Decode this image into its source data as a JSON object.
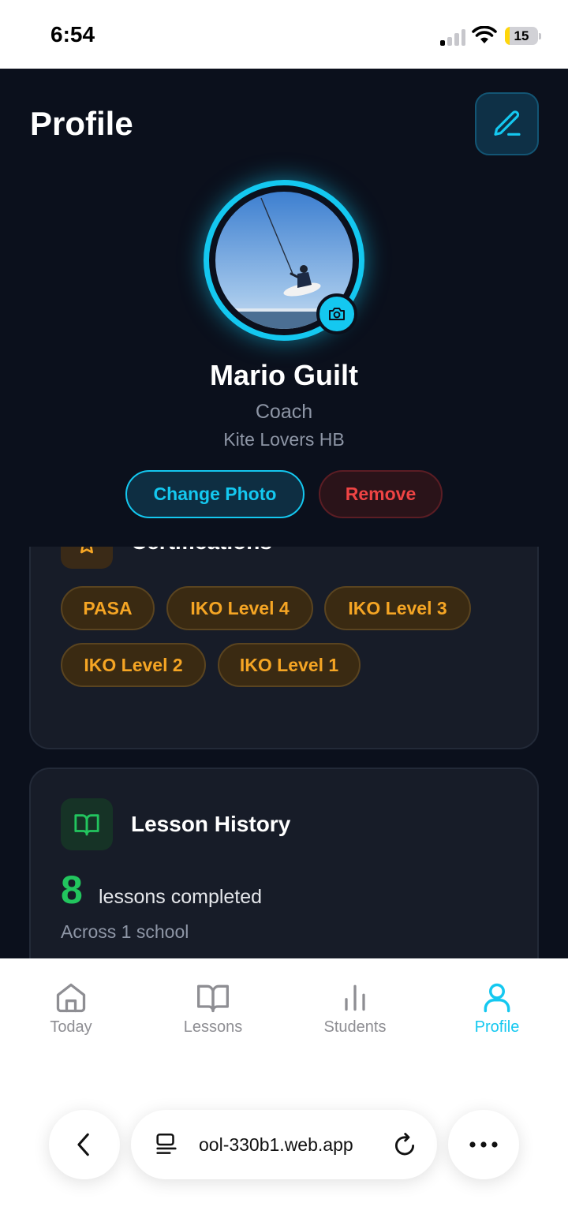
{
  "status_bar": {
    "time": "6:54",
    "battery": "15",
    "battery_level": 0.15,
    "icons": [
      "signal-icon",
      "wifi-icon",
      "battery-icon"
    ]
  },
  "header": {
    "title": "Profile",
    "edit_icon": "pencil-icon"
  },
  "profile": {
    "name": "Mario Guilt",
    "role": "Coach",
    "school": "Kite Lovers HB",
    "camera_icon": "camera-icon",
    "change_photo_label": "Change Photo",
    "remove_label": "Remove"
  },
  "certifications": {
    "title": "Certifications",
    "icon": "award-icon",
    "items": [
      "PASA",
      "IKO Level 4",
      "IKO Level 3",
      "IKO Level 2",
      "IKO Level 1"
    ]
  },
  "lesson_history": {
    "title": "Lesson History",
    "icon": "book-open-icon",
    "count": "8",
    "count_label": "lessons completed",
    "subtitle": "Across 1 school"
  },
  "tabbar": {
    "tabs": [
      {
        "label": "Today",
        "icon": "home-icon",
        "active": false
      },
      {
        "label": "Lessons",
        "icon": "book-open-icon",
        "active": false
      },
      {
        "label": "Students",
        "icon": "bar-chart-icon",
        "active": false
      },
      {
        "label": "Profile",
        "icon": "user-icon",
        "active": true
      }
    ]
  },
  "browser": {
    "url": "ool-330b1.web.app",
    "icons": [
      "back-icon",
      "tabs-icon",
      "reload-icon",
      "more-icon"
    ]
  },
  "colors": {
    "accent": "#14c8f0",
    "background": "#0b101c",
    "card": "#171c28",
    "danger": "#ef4444",
    "certification": "#f5a524",
    "success": "#22c55e"
  }
}
